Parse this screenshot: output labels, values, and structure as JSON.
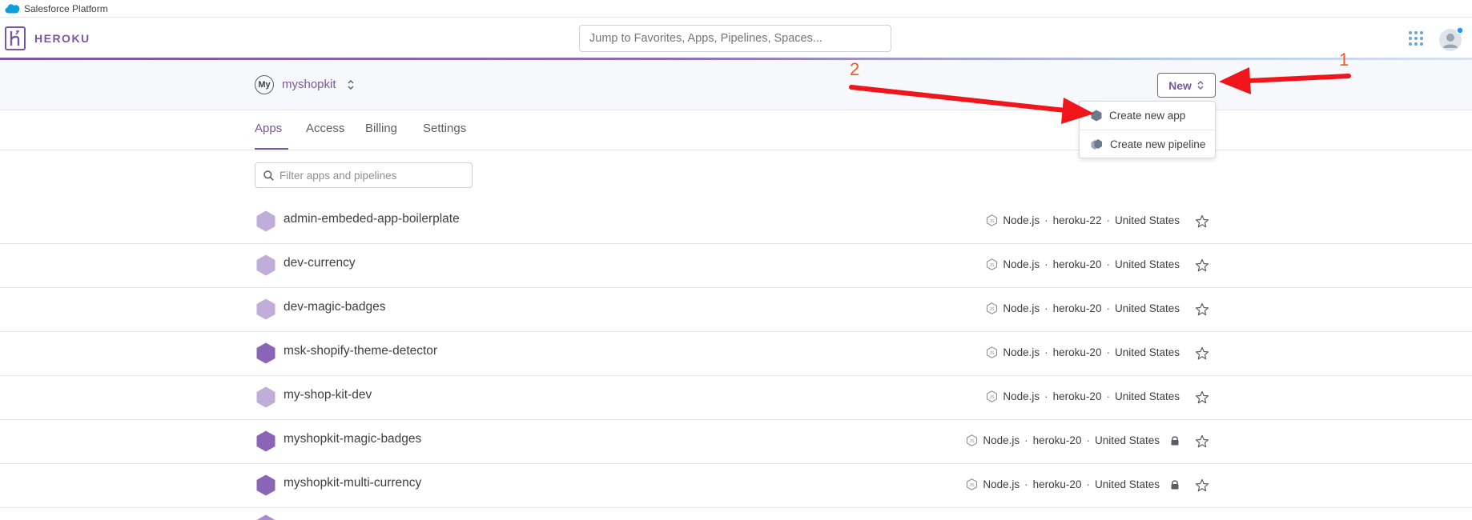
{
  "salesforce_bar": {
    "label": "Salesforce Platform"
  },
  "header": {
    "brand": "HEROKU",
    "search_placeholder": "Jump to Favorites, Apps, Pipelines, Spaces...",
    "icons": [
      "apps-grid-icon",
      "user-avatar-icon"
    ]
  },
  "account": {
    "badge": "My",
    "team_name": "myshopkit",
    "new_button": "New"
  },
  "tabs": [
    {
      "label": "Apps",
      "active": true
    },
    {
      "label": "Access",
      "active": false
    },
    {
      "label": "Billing",
      "active": false
    },
    {
      "label": "Settings",
      "active": false
    }
  ],
  "filter": {
    "placeholder": "Filter apps and pipelines"
  },
  "dropdown": {
    "items": [
      "Create new app",
      "Create new pipeline"
    ]
  },
  "apps": [
    {
      "name": "admin-embeded-app-boilerplate",
      "language": "Node.js",
      "stack": "heroku-22",
      "region": "United States",
      "locked": false,
      "shade": "light"
    },
    {
      "name": "dev-currency",
      "language": "Node.js",
      "stack": "heroku-20",
      "region": "United States",
      "locked": false,
      "shade": "light"
    },
    {
      "name": "dev-magic-badges",
      "language": "Node.js",
      "stack": "heroku-20",
      "region": "United States",
      "locked": false,
      "shade": "light"
    },
    {
      "name": "msk-shopify-theme-detector",
      "language": "Node.js",
      "stack": "heroku-20",
      "region": "United States",
      "locked": false,
      "shade": "dark"
    },
    {
      "name": "my-shop-kit-dev",
      "language": "Node.js",
      "stack": "heroku-20",
      "region": "United States",
      "locked": false,
      "shade": "light"
    },
    {
      "name": "myshopkit-magic-badges",
      "language": "Node.js",
      "stack": "heroku-20",
      "region": "United States",
      "locked": true,
      "shade": "dark"
    },
    {
      "name": "myshopkit-multi-currency",
      "language": "Node.js",
      "stack": "heroku-20",
      "region": "United States",
      "locked": true,
      "shade": "dark"
    }
  ],
  "separator": "·",
  "annotations": {
    "step1": "1",
    "step2": "2"
  },
  "colors": {
    "brand": "#79589f",
    "hex_light": "#c1add9",
    "hex_dark": "#8a64b6",
    "annotation": "#f0141b",
    "annotation_number": "#f05a24"
  }
}
